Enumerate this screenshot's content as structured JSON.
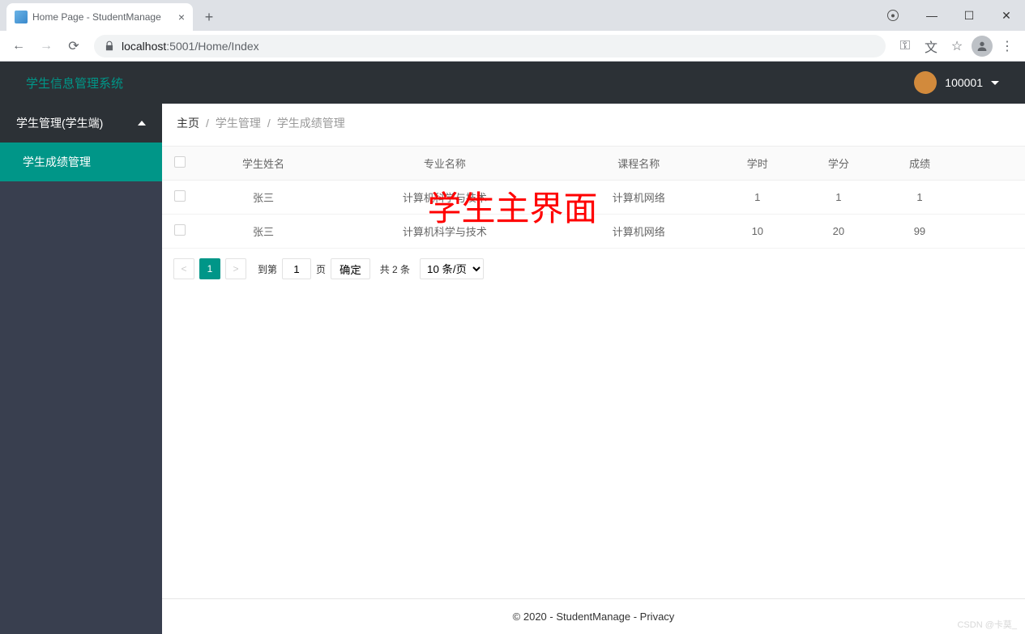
{
  "browser": {
    "tab_title": "Home Page - StudentManage",
    "url_host": "localhost",
    "url_port": ":5001",
    "url_path": "/Home/Index"
  },
  "app": {
    "brand": "学生信息管理系统",
    "user_id": "100001"
  },
  "sidebar": {
    "group": "学生管理(学生端)",
    "item1": "学生成绩管理"
  },
  "breadcrumb": {
    "home": "主页",
    "sep": "/",
    "l2": "学生管理",
    "l3": "学生成绩管理"
  },
  "overlay_title": "学生主界面",
  "table": {
    "headers": {
      "name": "学生姓名",
      "major": "专业名称",
      "course": "课程名称",
      "hours": "学时",
      "credit": "学分",
      "score": "成绩"
    },
    "rows": [
      {
        "name": "张三",
        "major": "计算机科学与技术",
        "course": "计算机网络",
        "hours": "1",
        "credit": "1",
        "score": "1"
      },
      {
        "name": "张三",
        "major": "计算机科学与技术",
        "course": "计算机网络",
        "hours": "10",
        "credit": "20",
        "score": "99"
      }
    ]
  },
  "pager": {
    "current": "1",
    "to_label": "到第",
    "page_input": "1",
    "page_suffix": "页",
    "confirm": "确定",
    "total": "共 2 条",
    "size": "10 条/页"
  },
  "footer": "© 2020 - StudentManage - Privacy",
  "watermark": "CSDN @卡莫_"
}
